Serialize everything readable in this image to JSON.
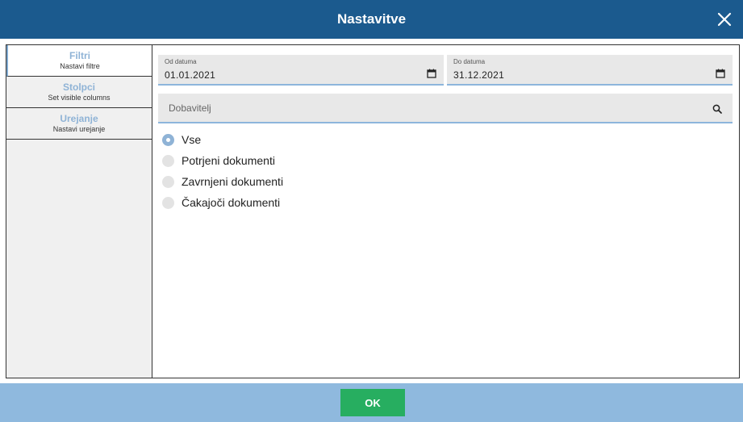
{
  "dialog": {
    "title": "Nastavitve"
  },
  "sidebar": {
    "items": [
      {
        "label": "Filtri",
        "sublabel": "Nastavi filtre",
        "active": true
      },
      {
        "label": "Stolpci",
        "sublabel": "Set visible columns",
        "active": false
      },
      {
        "label": "Urejanje",
        "sublabel": "Nastavi urejanje",
        "active": false
      }
    ]
  },
  "filters": {
    "date_from": {
      "label": "Od datuma",
      "value": "01.01.2021"
    },
    "date_to": {
      "label": "Do datuma",
      "value": "31.12.2021"
    },
    "supplier": {
      "placeholder": "Dobavitelj",
      "value": ""
    },
    "status_options": [
      {
        "label": "Vse",
        "checked": true
      },
      {
        "label": "Potrjeni dokumenti",
        "checked": false
      },
      {
        "label": "Zavrnjeni dokumenti",
        "checked": false
      },
      {
        "label": "Čakajoči dokumenti",
        "checked": false
      }
    ]
  },
  "footer": {
    "ok_label": "OK"
  },
  "colors": {
    "header_bg": "#1b5a8e",
    "footer_bg": "#8fb9de",
    "ok_button": "#27ae60",
    "accent": "#8fb3d6"
  }
}
